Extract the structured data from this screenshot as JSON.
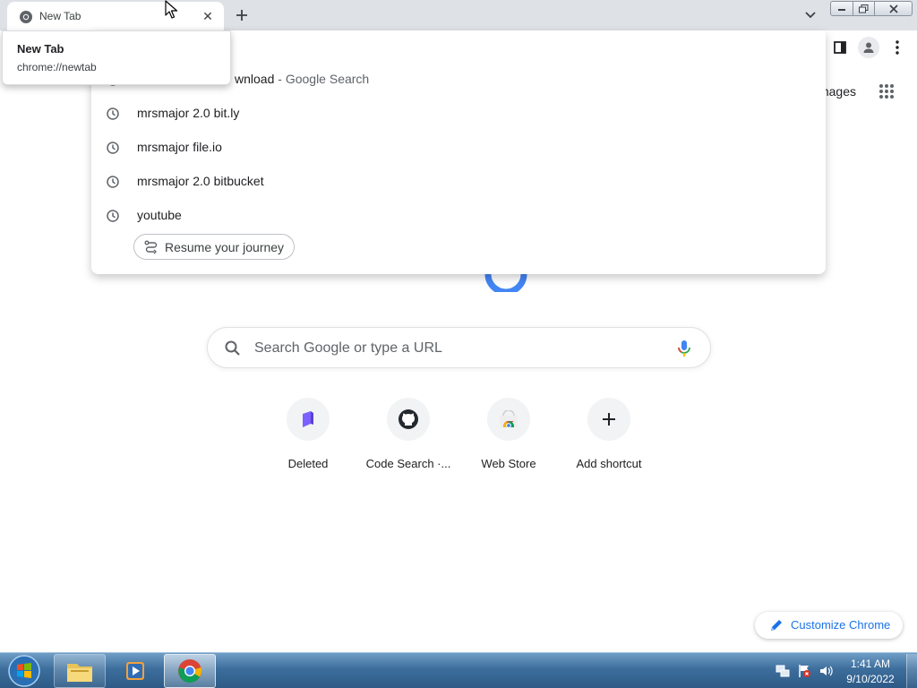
{
  "tab": {
    "title": "New Tab",
    "favicon": "chrome-icon"
  },
  "hover_card": {
    "title": "New Tab",
    "url": "chrome://newtab"
  },
  "omnibox_dropdown": {
    "partial_suggestion": {
      "visible_tail": "wnload",
      "suffix": "- Google Search"
    },
    "suggestions": [
      {
        "text": "mrsmajor 2.0 bit.ly",
        "icon": "clock-icon"
      },
      {
        "text": "mrsmajor file.io",
        "icon": "clock-icon"
      },
      {
        "text": "mrsmajor 2.0 bitbucket",
        "icon": "clock-icon"
      },
      {
        "text": "youtube",
        "icon": "clock-icon"
      }
    ],
    "resume_chip": "Resume your journey"
  },
  "ntp": {
    "images_link": "Images",
    "search_placeholder": "Search Google or type a URL",
    "shortcuts": [
      {
        "label": "Deleted",
        "icon": "deleted-icon"
      },
      {
        "label": "Code Search ·...",
        "icon": "github-icon"
      },
      {
        "label": "Web Store",
        "icon": "web-store-icon"
      },
      {
        "label": "Add shortcut",
        "icon": "plus-icon"
      }
    ],
    "customize_label": "Customize Chrome"
  },
  "taskbar": {
    "time": "1:41 AM",
    "date": "9/10/2022"
  },
  "colors": {
    "tab_strip": "#dee1e6",
    "accent_blue": "#1a73e8",
    "taskbar": "#3d6e9c"
  }
}
